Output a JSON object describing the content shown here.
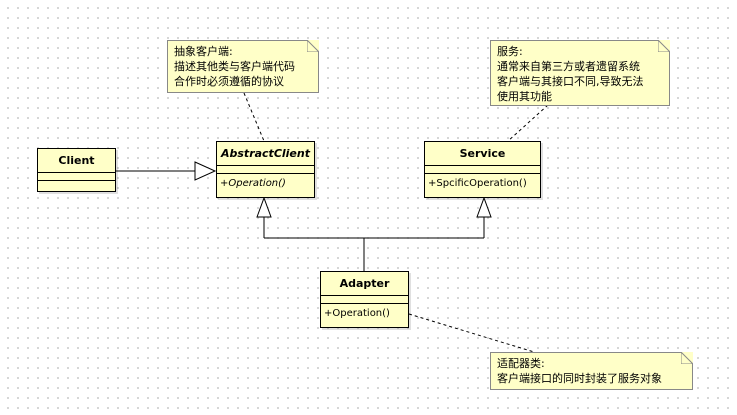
{
  "classes": {
    "client": {
      "name": "Client"
    },
    "abstract_client": {
      "name": "AbstractClient",
      "operation": "+Operation()"
    },
    "service": {
      "name": "Service",
      "operation": "+SpcificOperation()"
    },
    "adapter": {
      "name": "Adapter",
      "operation": "+Operation()"
    }
  },
  "notes": {
    "abstract_client": [
      "抽象客户端:",
      "描述其他类与客户端代码",
      "合作时必须遵循的协议"
    ],
    "service": [
      "服务:",
      "通常来自第三方或者遗留系统",
      "客户端与其接口不同,导致无法",
      "使用其功能"
    ],
    "adapter": [
      "适配器类:",
      "客户端接口的同时封装了服务对象"
    ]
  },
  "colors": {
    "class_fill": "#ffffc8",
    "line": "#000000",
    "grid_dot": "#c8c8c8"
  }
}
